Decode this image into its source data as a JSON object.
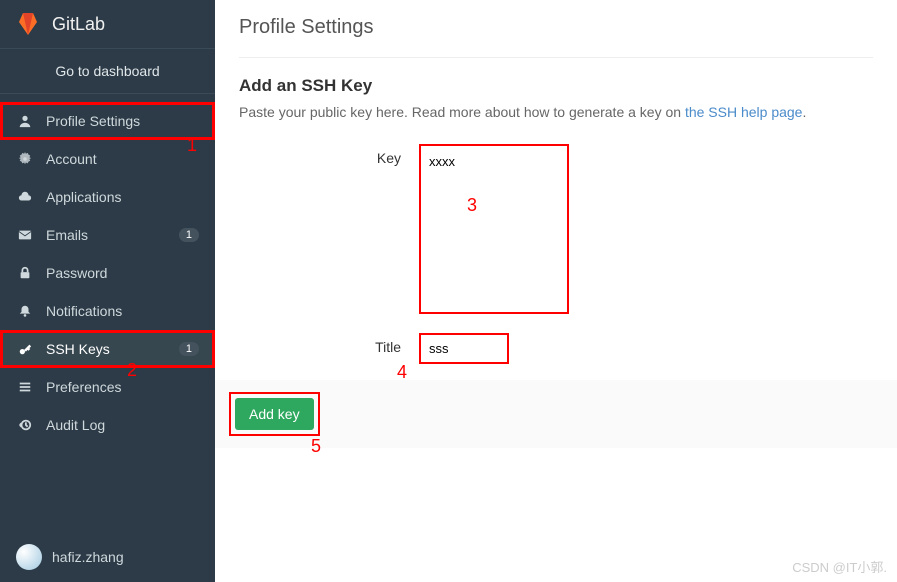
{
  "brand": "GitLab",
  "dashboard_link": "Go to dashboard",
  "sidebar": {
    "items": [
      {
        "label": "Profile Settings",
        "icon": "user-icon",
        "badge": ""
      },
      {
        "label": "Account",
        "icon": "gear-icon",
        "badge": ""
      },
      {
        "label": "Applications",
        "icon": "cloud-icon",
        "badge": ""
      },
      {
        "label": "Emails",
        "icon": "envelope-icon",
        "badge": "1"
      },
      {
        "label": "Password",
        "icon": "lock-icon",
        "badge": ""
      },
      {
        "label": "Notifications",
        "icon": "bell-icon",
        "badge": ""
      },
      {
        "label": "SSH Keys",
        "icon": "key-icon",
        "badge": "1"
      },
      {
        "label": "Preferences",
        "icon": "sliders-icon",
        "badge": ""
      },
      {
        "label": "Audit Log",
        "icon": "history-icon",
        "badge": ""
      }
    ]
  },
  "user": {
    "name": "hafiz.zhang"
  },
  "page": {
    "title": "Profile Settings",
    "section_title": "Add an SSH Key",
    "help_prefix": "Paste your public key here. Read more about how to generate a key on ",
    "help_link": "the SSH help page",
    "help_suffix": ".",
    "key_label": "Key",
    "key_value": "xxxx",
    "title_label": "Title",
    "title_value": "sss",
    "submit_label": "Add key"
  },
  "annotations": {
    "a1": "1",
    "a2": "2",
    "a3": "3",
    "a4": "4",
    "a5": "5"
  },
  "watermark": "CSDN @IT小郭."
}
